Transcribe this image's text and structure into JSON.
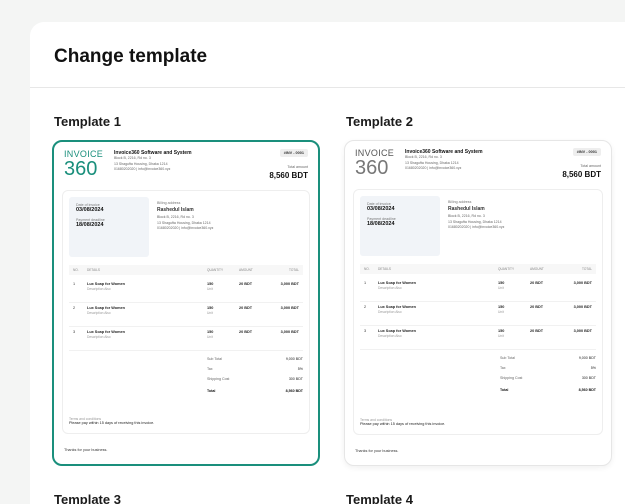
{
  "panel": {
    "title": "Change template"
  },
  "templates": [
    {
      "label": "Template 1"
    },
    {
      "label": "Template 2"
    },
    {
      "label": "Template 3"
    },
    {
      "label": "Template 4"
    }
  ],
  "invoice": {
    "logo_top": "INVOICE",
    "logo_bottom": "360",
    "company_name": "Invoice360 Software and System",
    "company_address_1": "Block B, 2216, Rd no. 3",
    "company_address_2": "13 Shagufta Housing, Dhaka 1214",
    "company_contact": "01680202020  |  info@invoice360.xyz",
    "invoice_number": "#INV - 0001",
    "total_amount_label": "Total amount",
    "total_amount": "8,560 BDT",
    "date_label": "Date of invoice",
    "date_value": "03/08/2024",
    "deadline_label": "Payment deadline",
    "deadline_value": "18/08/2024",
    "billing_label": "Billing address",
    "billing_name": "Rashedul Islam",
    "billing_address_1": "Block B, 2216, Rd no. 3",
    "billing_address_2": "13 Shagufta Housing, Dhaka 1214",
    "billing_contact": "01680202020  |  info@invoice360.xyz",
    "columns": {
      "no": "NO.",
      "details": "DETAILS",
      "quantity": "QUANTITY",
      "amount": "AMOUNT",
      "total": "TOTAL"
    },
    "items": [
      {
        "no": "1",
        "name": "Lux Soap for Women",
        "desc": "Description Also",
        "qty": "150",
        "unit": "Unit",
        "amount": "20 BDT",
        "total": "3,000 BDT"
      },
      {
        "no": "2",
        "name": "Lux Soap for Women",
        "desc": "Description Also",
        "qty": "150",
        "unit": "Unit",
        "amount": "20 BDT",
        "total": "3,000 BDT"
      },
      {
        "no": "3",
        "name": "Lux Soap for Women",
        "desc": "Description Also",
        "qty": "150",
        "unit": "Unit",
        "amount": "20 BDT",
        "total": "3,000 BDT"
      }
    ],
    "subtotal_label": "Sub Total",
    "subtotal": "9,000 BDT",
    "tax_label": "Tax",
    "tax": "5%",
    "shipping_label": "Shipping Cost",
    "shipping": "300 BDT",
    "total_label": "Total",
    "total": "8,560 BDT",
    "terms_label": "Terms and conditions",
    "terms_text": "Please pay within 15 days of receiving this invoice.",
    "thanks": "Thanks for your business."
  },
  "colors": {
    "accent": "#1a8f7c",
    "border": "#e6e6e6"
  }
}
